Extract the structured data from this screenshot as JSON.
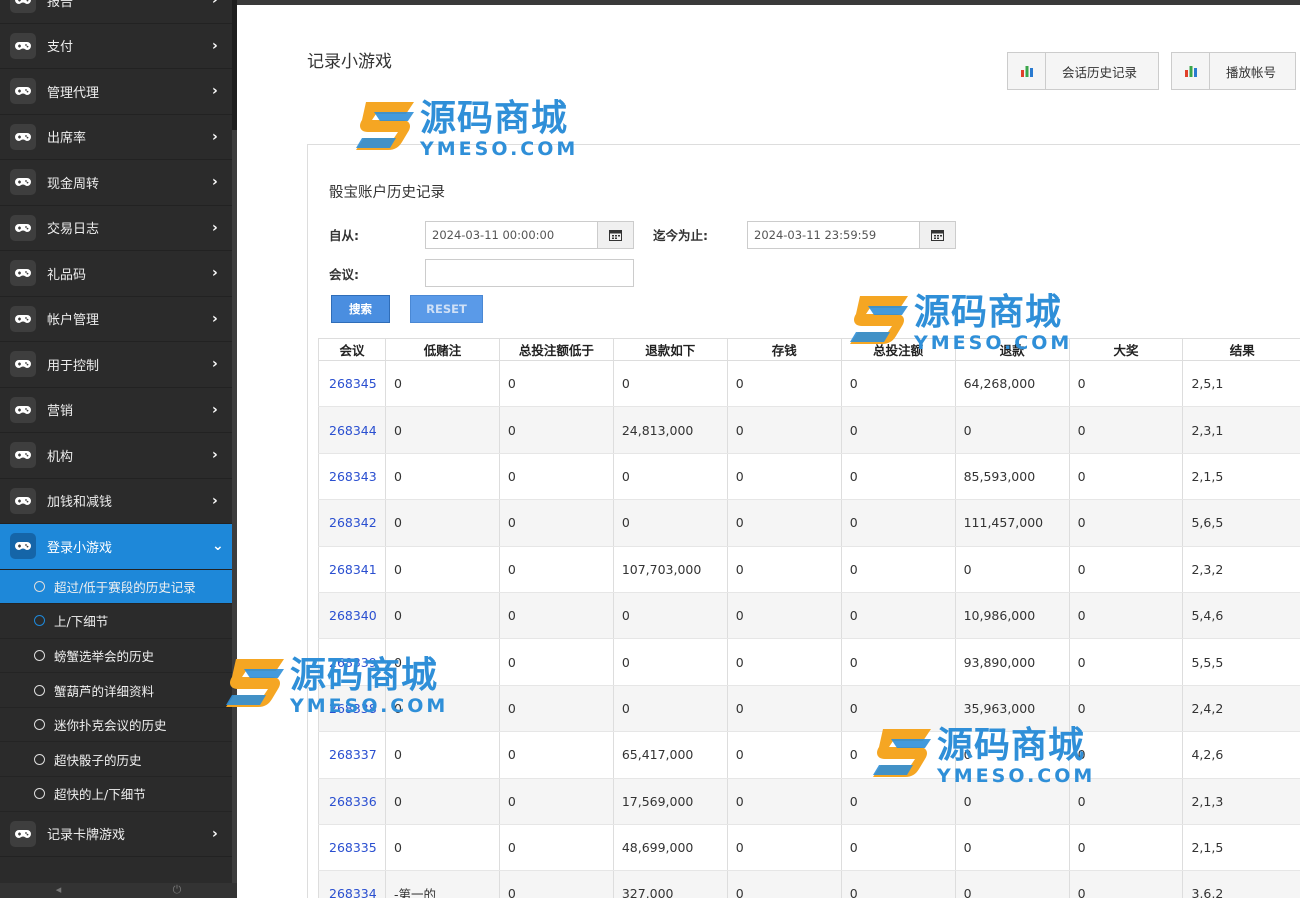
{
  "sidebar": {
    "items": [
      {
        "label": "报告"
      },
      {
        "label": "支付"
      },
      {
        "label": "管理代理"
      },
      {
        "label": "出席率"
      },
      {
        "label": "现金周转"
      },
      {
        "label": "交易日志"
      },
      {
        "label": "礼品码"
      },
      {
        "label": "帐户管理"
      },
      {
        "label": "用于控制"
      },
      {
        "label": "营销"
      },
      {
        "label": "机构"
      },
      {
        "label": "加钱和减钱"
      }
    ],
    "active_item": {
      "label": "登录小游戏"
    },
    "sub_items": [
      {
        "label": "超过/低于赛段的历史记录"
      },
      {
        "label": "上/下细节"
      },
      {
        "label": "螃蟹选举会的历史"
      },
      {
        "label": "蟹葫芦的详细资料"
      },
      {
        "label": "迷你扑克会议的历史"
      },
      {
        "label": "超快骰子的历史"
      },
      {
        "label": "超快的上/下细节"
      }
    ],
    "last_item": {
      "label": "记录卡牌游戏"
    }
  },
  "header": {
    "title": "记录小游戏",
    "session_history_button": "会话历史记录",
    "play_account_button": "播放帐号"
  },
  "panel": {
    "title": "骰宝账户历史记录",
    "from_label": "自从:",
    "from_value": "2024-03-11 00:00:00",
    "to_label": "迄今为止:",
    "to_value": "2024-03-11 23:59:59",
    "session_label": "会议:",
    "session_value": "",
    "search_button": "搜索",
    "reset_button": "RESET"
  },
  "table": {
    "headers": [
      "会议",
      "低赌注",
      "总投注额低于",
      "退款如下",
      "存钱",
      "总投注额",
      "退款",
      "大奖",
      "结果"
    ],
    "rows": [
      [
        "268345",
        "0",
        "0",
        "0",
        "0",
        "0",
        "64,268,000",
        "0",
        "2,5,1"
      ],
      [
        "268344",
        "0",
        "0",
        "24,813,000",
        "0",
        "0",
        "0",
        "0",
        "2,3,1"
      ],
      [
        "268343",
        "0",
        "0",
        "0",
        "0",
        "0",
        "85,593,000",
        "0",
        "2,1,5"
      ],
      [
        "268342",
        "0",
        "0",
        "0",
        "0",
        "0",
        "111,457,000",
        "0",
        "5,6,5"
      ],
      [
        "268341",
        "0",
        "0",
        "107,703,000",
        "0",
        "0",
        "0",
        "0",
        "2,3,2"
      ],
      [
        "268340",
        "0",
        "0",
        "0",
        "0",
        "0",
        "10,986,000",
        "0",
        "5,4,6"
      ],
      [
        "268339",
        "0",
        "0",
        "0",
        "0",
        "0",
        "93,890,000",
        "0",
        "5,5,5"
      ],
      [
        "268338",
        "0",
        "0",
        "0",
        "0",
        "0",
        "35,963,000",
        "0",
        "2,4,2"
      ],
      [
        "268337",
        "0",
        "0",
        "65,417,000",
        "0",
        "0",
        "0",
        "0",
        "4,2,6"
      ],
      [
        "268336",
        "0",
        "0",
        "17,569,000",
        "0",
        "0",
        "0",
        "0",
        "2,1,3"
      ],
      [
        "268335",
        "0",
        "0",
        "48,699,000",
        "0",
        "0",
        "0",
        "0",
        "2,1,5"
      ],
      [
        "268334",
        "-第一的",
        "0",
        "327,000",
        "0",
        "0",
        "0",
        "0",
        "3,6,2"
      ]
    ]
  },
  "watermark": {
    "cn": "源码商城",
    "en": "YMESO.COM"
  },
  "colors": {
    "accent": "#1e88d9",
    "link": "#2a4fd0",
    "sidebar_bg": "#2b2b2b"
  },
  "icons": {
    "menu": "gamepad-icon",
    "chevron": "chevron-right-icon",
    "chart": "bar-chart-icon",
    "calendar": "calendar-icon"
  }
}
